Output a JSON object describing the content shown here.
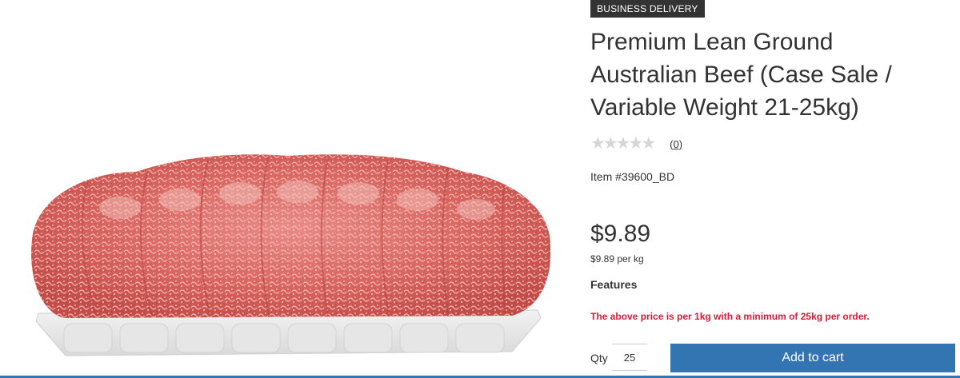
{
  "product": {
    "badge": "BUSINESS DELIVERY",
    "title": "Premium Lean Ground Australian Beef (Case Sale / Variable Weight 21-25kg)",
    "rating": {
      "stars_filled": 0,
      "stars_total": 5,
      "review_count_label": "(0)"
    },
    "item_number": "Item #39600_BD",
    "price": "$9.89",
    "unit_price": "$9.89 per kg",
    "features_heading": "Features",
    "notice": "The above price is per 1kg with a minimum of 25kg per order."
  },
  "purchase": {
    "qty_label": "Qty",
    "qty_value": "25",
    "add_to_cart_label": "Add to cart"
  },
  "colors": {
    "accent_button": "#3374b3",
    "notice_text": "#e31837",
    "badge_bg": "#333333",
    "star_empty": "#d6d6d6"
  }
}
